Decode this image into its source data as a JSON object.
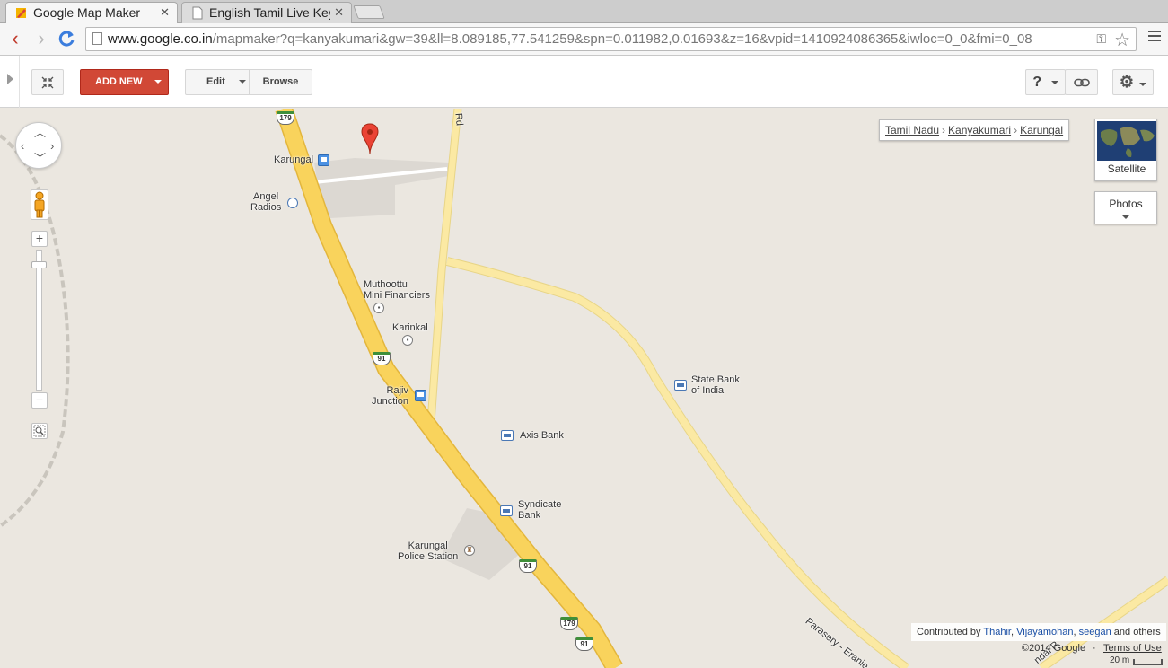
{
  "browser": {
    "tabs": [
      {
        "title": "Google Map Maker",
        "active": true
      },
      {
        "title": "English Tamil Live Key",
        "active": false
      }
    ],
    "url_domain": "www.google.co.in",
    "url_path": "/mapmaker?q=kanyakumari&gw=39&ll=8.089185,77.541259&spn=0.011982,0.01693&z=16&vpid=1410924086365&iwloc=0_0&fmi=0_08"
  },
  "toolbar": {
    "add_new_label": "ADD NEW",
    "edit_label": "Edit",
    "browse_label": "Browse",
    "help_label": "?"
  },
  "map": {
    "breadcrumb": [
      "Tamil Nadu",
      "Kanyakumari",
      "Karungal"
    ],
    "satellite_label": "Satellite",
    "photos_label": "Photos",
    "road_label_rd": "Rd",
    "road_label_parasery": "Parasery - Eranie",
    "road_label_bottom": "ndai R",
    "shields": [
      "179",
      "91",
      "91",
      "91",
      "179",
      "91"
    ],
    "pois": {
      "karungal": "Karungal",
      "angel_radios": [
        "Angel",
        "Radios"
      ],
      "muthoottu": [
        "Muthoottu",
        "Mini Financiers"
      ],
      "karinkal": "Karinkal",
      "rajiv_junction": [
        "Rajiv",
        "Junction"
      ],
      "state_bank": [
        "State Bank",
        "of India"
      ],
      "axis_bank": "Axis Bank",
      "syndicate_bank": [
        "Syndicate",
        "Bank"
      ],
      "police_station": [
        "Karungal",
        "Police Station"
      ]
    },
    "contributed_prefix": "Contributed by",
    "contributors": [
      "Thahir",
      "Vijayamohan",
      "seegan"
    ],
    "contributed_suffix": "and others",
    "copyright": "©2014 Google",
    "terms": "Terms of Use",
    "scale": "20 m"
  },
  "colors": {
    "highway": "#f9d35c",
    "highway_edge": "#e3b63c",
    "minor_road": "#fbe9a3",
    "land": "#ebe7e0",
    "accent_red": "#d14836"
  }
}
